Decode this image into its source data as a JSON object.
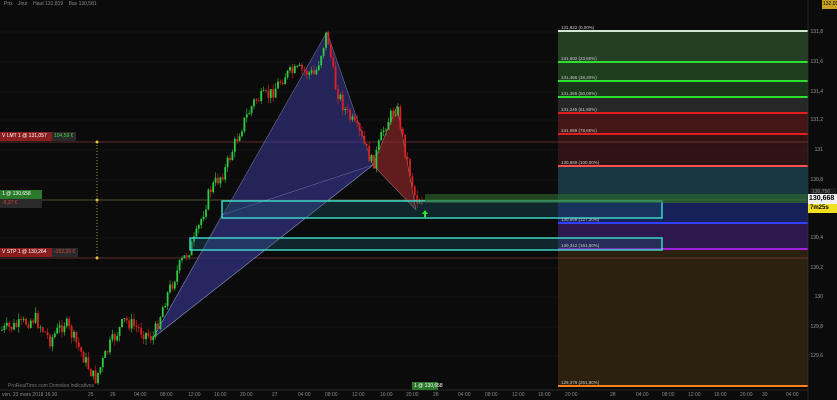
{
  "header": {
    "instrument": "Prix",
    "period": "Jour",
    "high_text": "Haut 131,819",
    "low_text": "Bas 130,581"
  },
  "orders": {
    "limit": {
      "label": "V LMT 1 @ 131,057",
      "value": "104,59 €"
    },
    "position": {
      "label": "1 @ 130,658",
      "pnl": "-9,27 €"
    },
    "stop": {
      "label": "V STP 1 @ 130,264",
      "value": "-152,39 €"
    }
  },
  "price_axis": {
    "ticks": [
      "131,8",
      "131,6",
      "131,4",
      "131,2",
      "131",
      "130,8",
      "130,4",
      "130,2",
      "130",
      "129,8",
      "129,6"
    ],
    "top_corner": "132,018",
    "last_price": "130,668",
    "countdown": "7m25s",
    "small_level": "130,756"
  },
  "time_axis": {
    "labels": [
      "ven. 23 mars 2018 16:30",
      "25",
      "26",
      "04:00",
      "08:00",
      "12:00",
      "16:00",
      "20:00",
      "27",
      "04:00",
      "08:00",
      "12:00",
      "16:00",
      "20:00",
      "28",
      "04:00",
      "08:00",
      "12:00",
      "16:00",
      "20:00",
      "28",
      "04:00",
      "08:00",
      "12:00",
      "16:00",
      "20:00",
      "30",
      "04:00"
    ]
  },
  "fib_levels": [
    "131,822 (0,00%)",
    "131,602 (23,60%)",
    "131,466 (38,20%)",
    "131,355 (50,00%)",
    "131,245 (61,80%)",
    "131,089 (78,60%)",
    "130,889 (100,00%)",
    "130,556 (127,20%)",
    "130,312 (161,80%)",
    "129,379 (261,80%)"
  ],
  "footer": {
    "watermark": "ProRealTime.com Données indicatives",
    "entry_tag": "1 @ 130,658"
  },
  "colors": {
    "background": "#0b0b0b",
    "candle_up": "#2ecc40",
    "candle_down": "#e02020",
    "pattern_left": "#3a3a9a",
    "pattern_right": "#9a2a2a",
    "box": "#3fe0d0"
  }
}
